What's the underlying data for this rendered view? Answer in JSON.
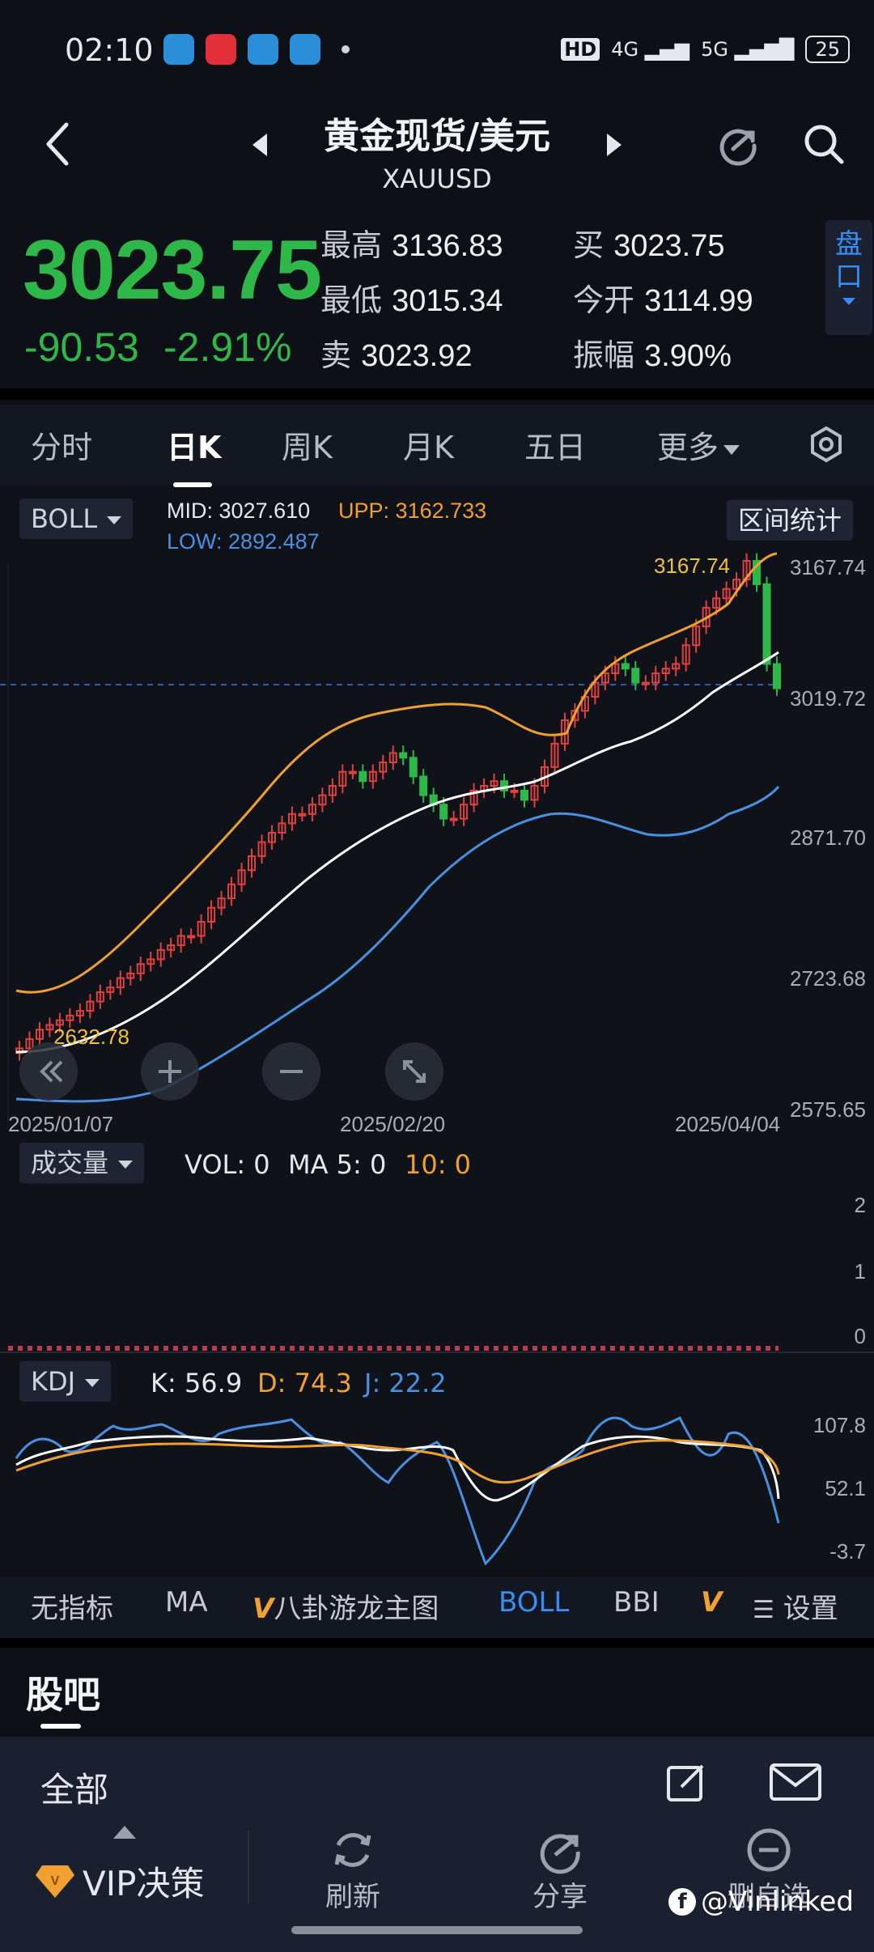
{
  "status": {
    "time": "02:10",
    "hd": "HD",
    "net1": "4G",
    "net2": "5G",
    "battery": "25"
  },
  "header": {
    "title": "黄金现货/美元",
    "symbol": "XAUUSD"
  },
  "quote": {
    "price": "3023.75",
    "change": "-90.53",
    "change_pct": "-2.91%",
    "high_label": "最高",
    "high": "3136.83",
    "low_label": "最低",
    "low": "3015.34",
    "sell_label": "卖",
    "sell": "3023.92",
    "buy_label": "买",
    "buy": "3023.75",
    "open_label": "今开",
    "open": "3114.99",
    "amp_label": "振幅",
    "amp": "3.90%",
    "pankou": "盘口"
  },
  "tabs": [
    "分时",
    "日K",
    "周K",
    "月K",
    "五日",
    "更多"
  ],
  "boll": {
    "indicator": "BOLL",
    "mid_label": "MID:",
    "mid": "3027.610",
    "upp_label": "UPP:",
    "upp": "3162.733",
    "low_label": "LOW:",
    "low": "2892.487",
    "range_btn": "区间统计",
    "max_tag": "3167.74",
    "min_tag": "2632.78"
  },
  "y_axis": [
    "3167.74",
    "3019.72",
    "2871.70",
    "2723.68",
    "2575.65"
  ],
  "x_axis": [
    "2025/01/07",
    "2025/02/20",
    "2025/04/04"
  ],
  "volume": {
    "indicator": "成交量",
    "vol": "VOL: 0",
    "ma5": "MA 5: 0",
    "ma10": "10: 0",
    "axis": [
      "2",
      "1",
      "0"
    ]
  },
  "kdj": {
    "indicator": "KDJ",
    "k": "K: 56.9",
    "d": "D: 74.3",
    "j": "J: 22.2",
    "axis": [
      "107.8",
      "52.1",
      "-3.7"
    ]
  },
  "indicators": [
    "无指标",
    "MA",
    "八卦游龙主图",
    "BOLL",
    "BBI",
    "设置"
  ],
  "guba": {
    "title": "股吧",
    "filter": "全部"
  },
  "bottom_bar": [
    "VIP决策",
    "刷新",
    "分享",
    "删自选"
  ],
  "watermark": "@Vinlinked",
  "colors": {
    "up": "#e0413f",
    "down": "#2fb84a",
    "upp": "#f0a030",
    "mid": "#ffffff",
    "low": "#4a90e2",
    "k": "#ffffff",
    "d": "#f0a030",
    "j": "#4a90e2"
  },
  "chart_data": {
    "type": "candlestick",
    "x_range": [
      "2025/01/07",
      "2025/04/04"
    ],
    "ylim": [
      2575.65,
      3167.74
    ],
    "closes_approx": [
      2640,
      2650,
      2660,
      2665,
      2670,
      2675,
      2680,
      2690,
      2700,
      2705,
      2715,
      2720,
      2730,
      2735,
      2745,
      2750,
      2760,
      2760,
      2775,
      2790,
      2800,
      2815,
      2830,
      2845,
      2860,
      2870,
      2880,
      2890,
      2890,
      2900,
      2910,
      2920,
      2935,
      2935,
      2925,
      2935,
      2945,
      2955,
      2950,
      2930,
      2910,
      2900,
      2885,
      2885,
      2900,
      2915,
      2920,
      2925,
      2915,
      2915,
      2905,
      2920,
      2940,
      2965,
      2990,
      3000,
      3015,
      3030,
      3040,
      3050,
      3045,
      3030,
      3030,
      3040,
      3045,
      3050,
      3070,
      3090,
      3110,
      3120,
      3130,
      3140,
      3160,
      3135,
      3050,
      3024
    ]
  }
}
